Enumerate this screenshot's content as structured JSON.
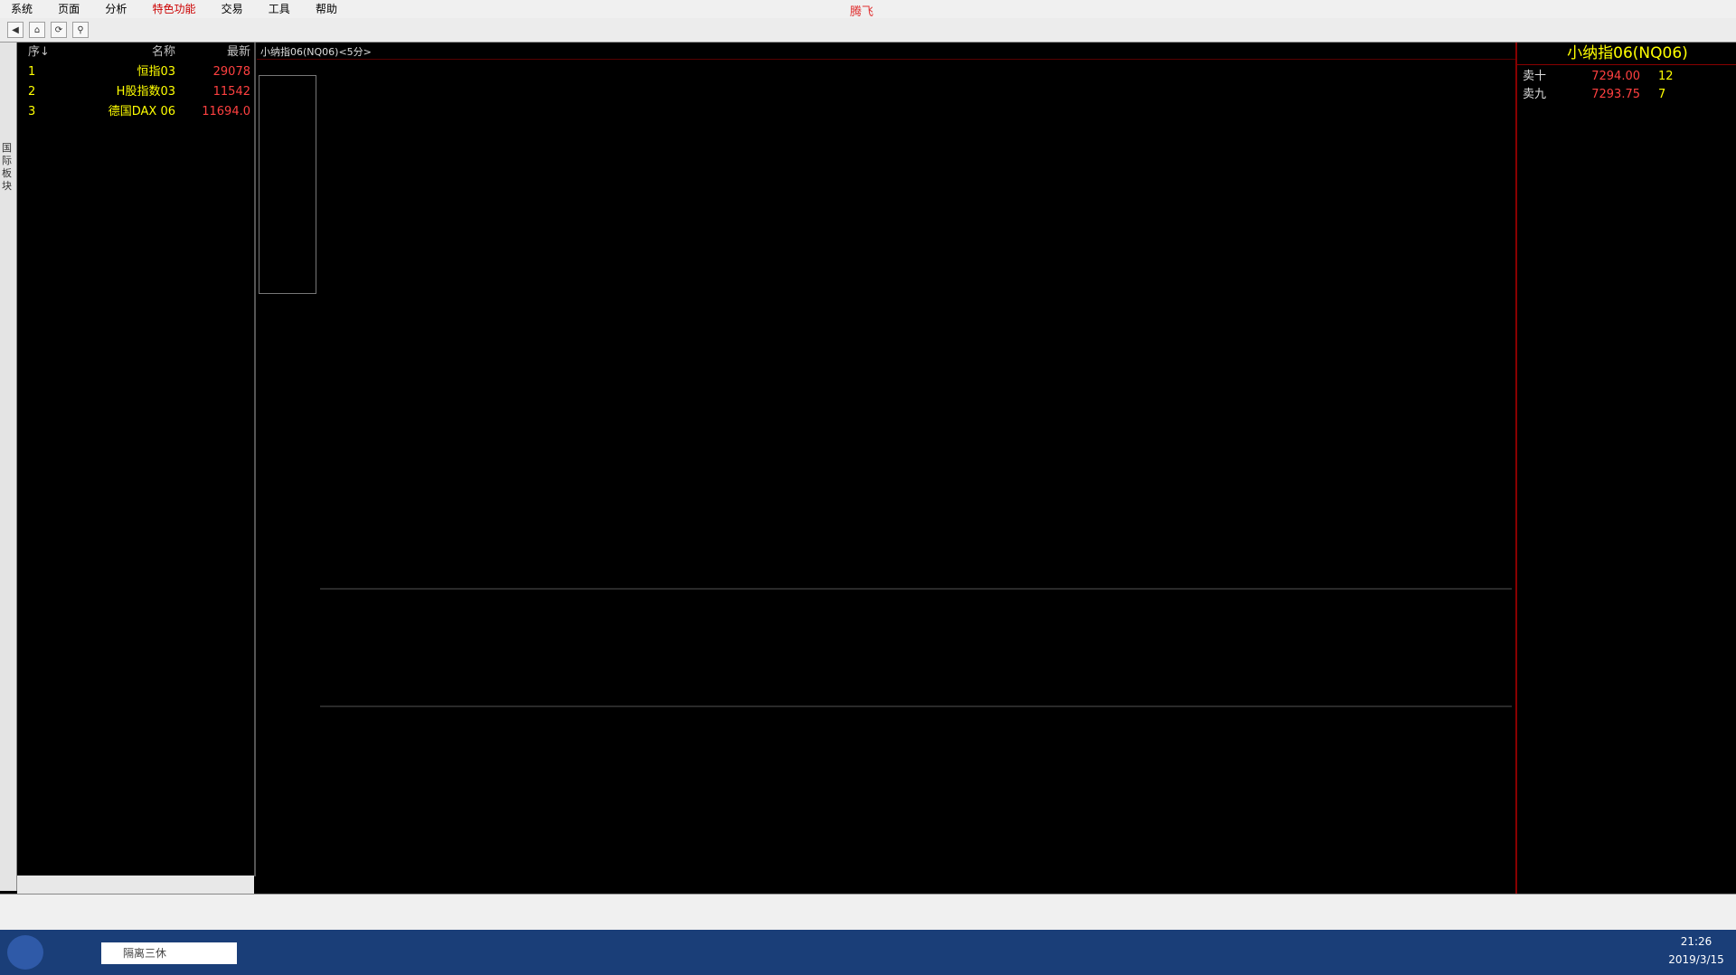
{
  "menubar": {
    "items": [
      {
        "label": "系统"
      },
      {
        "label": "页面"
      },
      {
        "label": "分析"
      },
      {
        "label": "特色功能"
      },
      {
        "label": "交易"
      },
      {
        "label": "工具"
      },
      {
        "label": "帮助"
      }
    ],
    "app_title": "腾飞"
  },
  "left_tab": {
    "label": "国际板块"
  },
  "quote_list": {
    "header": {
      "seq": "序↓",
      "name": "名称",
      "price": "最新"
    },
    "rows": [
      {
        "seq": "1",
        "name": "恒指03",
        "price": "29078"
      },
      {
        "seq": "2",
        "name": "H股指数03",
        "price": "11542"
      },
      {
        "seq": "3",
        "name": "德国DAX 06",
        "price": "11694.0"
      }
    ]
  },
  "chart": {
    "tab_title": "小纳指06(NQ06)<5分>"
  },
  "right_panel": {
    "title": "小纳指06(NQ06)",
    "sell_rows": [
      {
        "label": "卖十",
        "price": "7294.00",
        "vol": "12"
      },
      {
        "label": "卖九",
        "price": "7293.75",
        "vol": "7"
      }
    ]
  },
  "taskbar": {
    "search_placeholder": "隔离三休",
    "time": "21:26",
    "date": "2019/3/15"
  }
}
